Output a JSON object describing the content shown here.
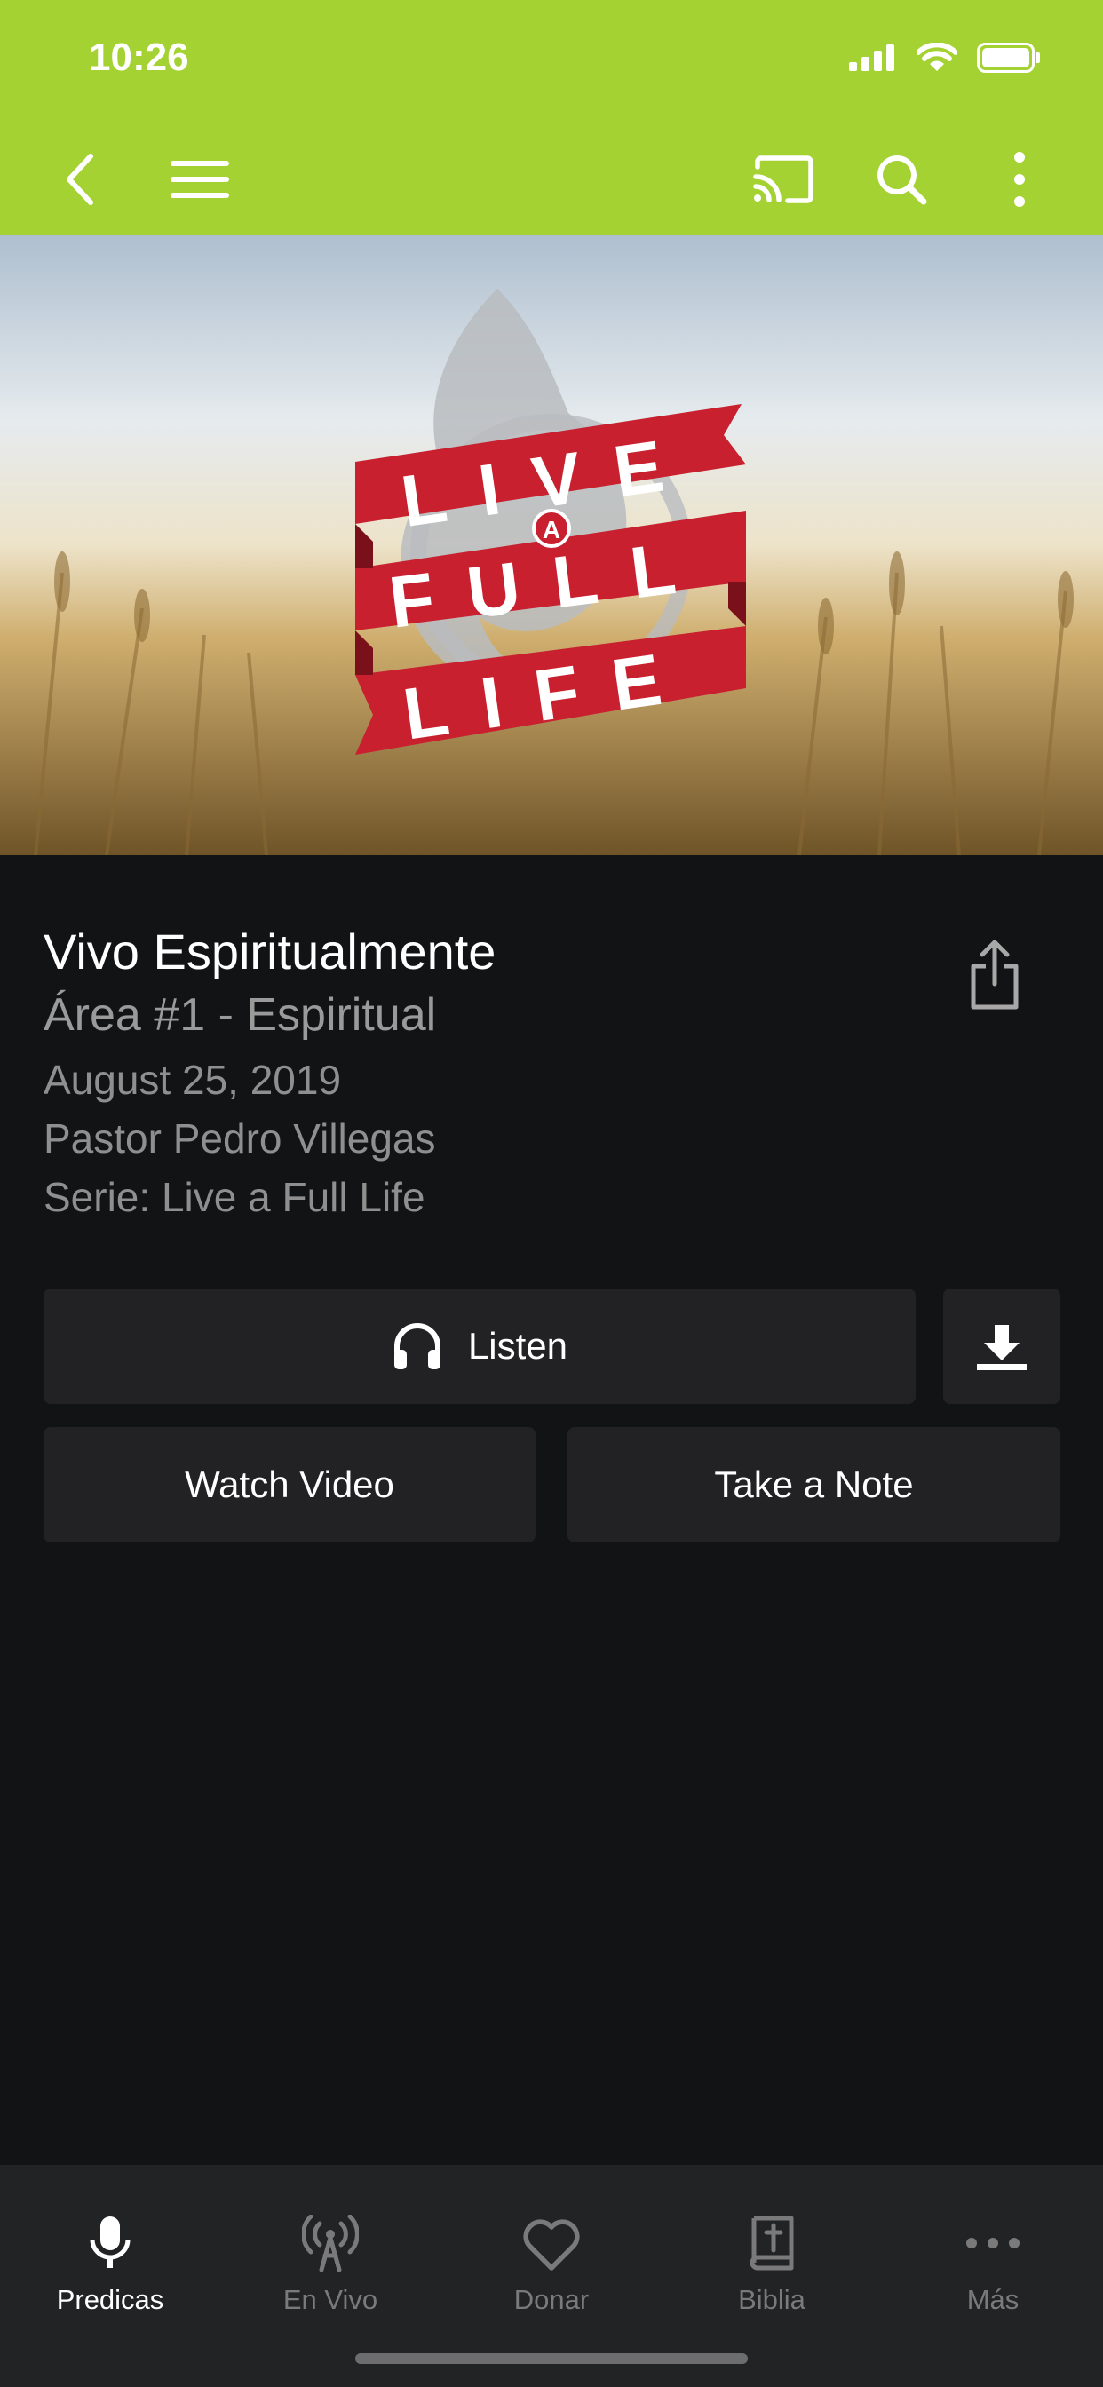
{
  "status_bar": {
    "time": "10:26"
  },
  "colors": {
    "accent": "#a4d233",
    "background": "#121315",
    "button": "#222224",
    "tab_bar": "#222325"
  },
  "nav": {
    "icons": [
      "back-icon",
      "menu-icon",
      "cast-icon",
      "search-icon",
      "more-vertical-icon"
    ]
  },
  "hero": {
    "logo_line1": "LIVE",
    "logo_badge": "A",
    "logo_line2": "FULL",
    "logo_line3": "LIFE"
  },
  "sermon": {
    "title": "Vivo Espiritualmente",
    "subtitle": "Área #1 - Espiritual",
    "date": "August 25, 2019",
    "speaker": "Pastor Pedro Villegas",
    "series": "Serie: Live a Full Life"
  },
  "actions": {
    "listen": "Listen",
    "watch_video": "Watch Video",
    "take_note": "Take a Note"
  },
  "tabs": [
    {
      "label": "Predicas",
      "icon": "microphone-icon",
      "active": true
    },
    {
      "label": "En Vivo",
      "icon": "broadcast-icon",
      "active": false
    },
    {
      "label": "Donar",
      "icon": "heart-icon",
      "active": false
    },
    {
      "label": "Biblia",
      "icon": "bible-icon",
      "active": false
    },
    {
      "label": "Más",
      "icon": "more-horizontal-icon",
      "active": false
    }
  ]
}
